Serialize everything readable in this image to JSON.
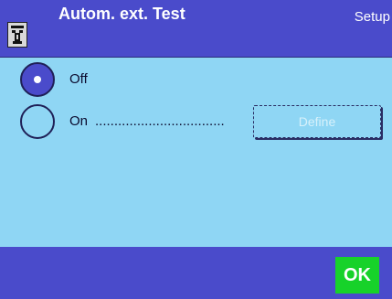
{
  "header": {
    "title": "Autom. ext. Test",
    "context": "Setup",
    "icon": "balance-icon"
  },
  "options": [
    {
      "label": "Off",
      "selected": true
    },
    {
      "label": "On",
      "dots": "..................................",
      "selected": false
    }
  ],
  "define_button": {
    "label": "Define",
    "enabled": false
  },
  "footer": {
    "ok_label": "OK"
  },
  "colors": {
    "screen_bg": "#8fd6f4",
    "bar_bg": "#4a4bcb",
    "ok_green": "#17d22a",
    "radio_border": "#1f2057"
  }
}
